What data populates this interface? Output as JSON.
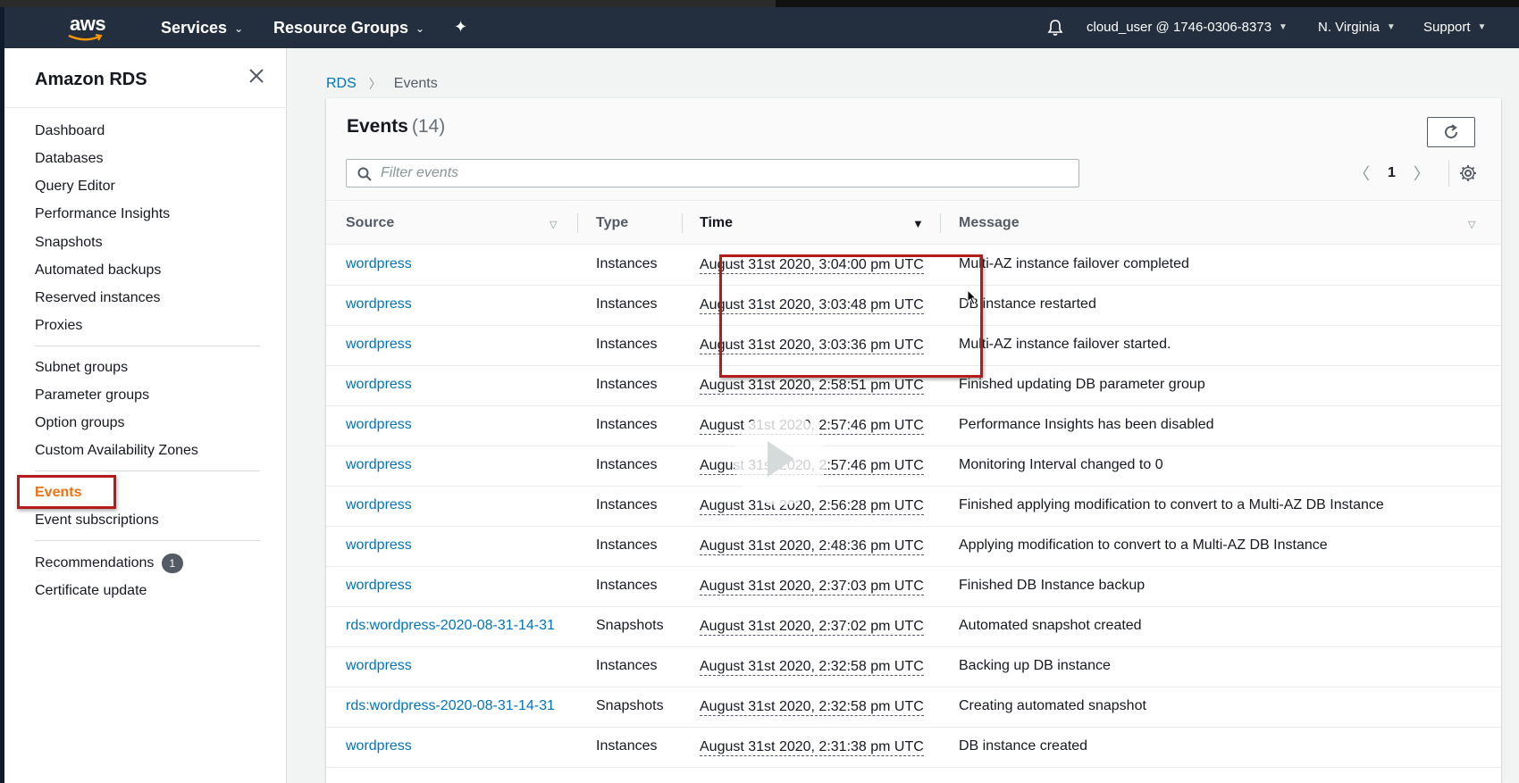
{
  "topnav": {
    "logo_text": "aws",
    "services_label": "Services",
    "resource_groups_label": "Resource Groups",
    "account_label": "cloud_user @ 1746-0306-8373",
    "region_label": "N. Virginia",
    "support_label": "Support"
  },
  "sidebar": {
    "title": "Amazon RDS",
    "items": [
      {
        "label": "Dashboard"
      },
      {
        "label": "Databases"
      },
      {
        "label": "Query Editor"
      },
      {
        "label": "Performance Insights"
      },
      {
        "label": "Snapshots"
      },
      {
        "label": "Automated backups"
      },
      {
        "label": "Reserved instances"
      },
      {
        "label": "Proxies"
      },
      {
        "label": "Subnet groups"
      },
      {
        "label": "Parameter groups"
      },
      {
        "label": "Option groups"
      },
      {
        "label": "Custom Availability Zones"
      },
      {
        "label": "Events"
      },
      {
        "label": "Event subscriptions"
      },
      {
        "label": "Recommendations",
        "badge": "1"
      },
      {
        "label": "Certificate update"
      }
    ],
    "active_item": "Events"
  },
  "breadcrumb": {
    "root": "RDS",
    "current": "Events"
  },
  "events": {
    "title": "Events",
    "count": "(14)",
    "search_placeholder": "Filter events",
    "current_page": "1",
    "columns": {
      "source": "Source",
      "type": "Type",
      "time": "Time",
      "message": "Message"
    },
    "rows": [
      {
        "source": "wordpress",
        "type": "Instances",
        "time": "August 31st 2020, 3:04:00 pm UTC",
        "message": "Multi-AZ instance failover completed"
      },
      {
        "source": "wordpress",
        "type": "Instances",
        "time": "August 31st 2020, 3:03:48 pm UTC",
        "message": "DB instance restarted"
      },
      {
        "source": "wordpress",
        "type": "Instances",
        "time": "August 31st 2020, 3:03:36 pm UTC",
        "message": "Multi-AZ instance failover started."
      },
      {
        "source": "wordpress",
        "type": "Instances",
        "time": "August 31st 2020, 2:58:51 pm UTC",
        "message": "Finished updating DB parameter group"
      },
      {
        "source": "wordpress",
        "type": "Instances",
        "time": "August 31st 2020, 2:57:46 pm UTC",
        "message": "Performance Insights has been disabled"
      },
      {
        "source": "wordpress",
        "type": "Instances",
        "time": "August 31st 2020, 2:57:46 pm UTC",
        "message": "Monitoring Interval changed to 0"
      },
      {
        "source": "wordpress",
        "type": "Instances",
        "time": "August 31st 2020, 2:56:28 pm UTC",
        "message": "Finished applying modification to convert to a Multi-AZ DB Instance"
      },
      {
        "source": "wordpress",
        "type": "Instances",
        "time": "August 31st 2020, 2:48:36 pm UTC",
        "message": "Applying modification to convert to a Multi-AZ DB Instance"
      },
      {
        "source": "wordpress",
        "type": "Instances",
        "time": "August 31st 2020, 2:37:03 pm UTC",
        "message": "Finished DB Instance backup"
      },
      {
        "source": "rds:wordpress-2020-08-31-14-31",
        "type": "Snapshots",
        "time": "August 31st 2020, 2:37:02 pm UTC",
        "message": "Automated snapshot created"
      },
      {
        "source": "wordpress",
        "type": "Instances",
        "time": "August 31st 2020, 2:32:58 pm UTC",
        "message": "Backing up DB instance"
      },
      {
        "source": "rds:wordpress-2020-08-31-14-31",
        "type": "Snapshots",
        "time": "August 31st 2020, 2:32:58 pm UTC",
        "message": "Creating automated snapshot"
      },
      {
        "source": "wordpress",
        "type": "Instances",
        "time": "August 31st 2020, 2:31:38 pm UTC",
        "message": "DB instance created"
      }
    ]
  },
  "colors": {
    "nav_bg": "#232f3e",
    "link": "#0073bb",
    "active_orange": "#ec7211",
    "highlight_red": "#b41c1c"
  },
  "icons": [
    "bell-icon",
    "pin-icon",
    "close-icon",
    "refresh-icon",
    "search-icon",
    "gear-icon",
    "play-icon",
    "sort-icon"
  ]
}
